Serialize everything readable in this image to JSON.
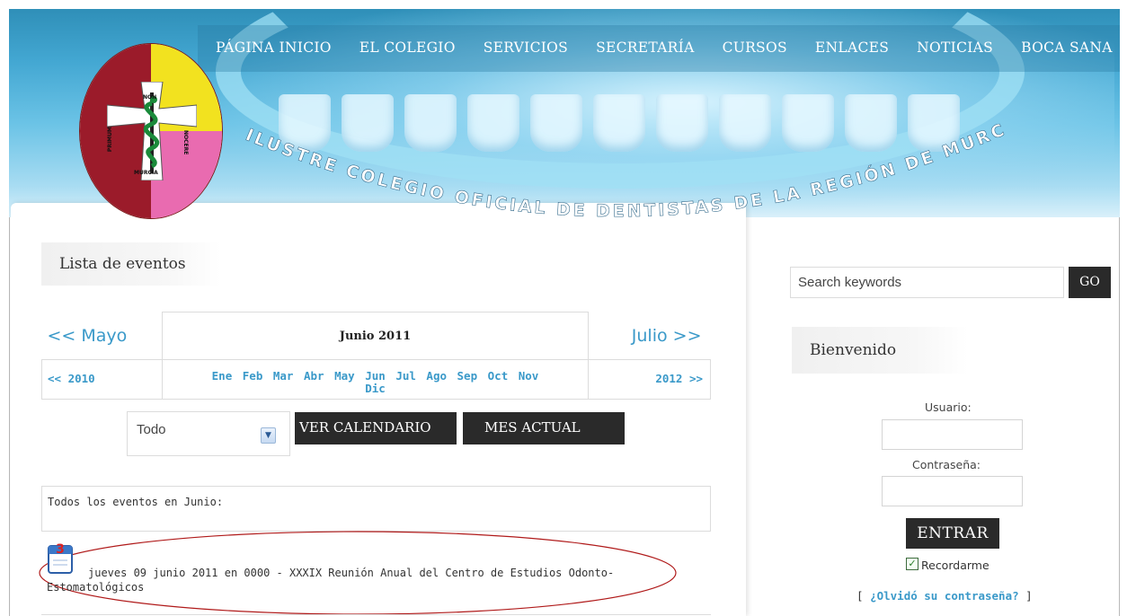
{
  "nav": {
    "items": [
      "PÁGINA INICIO",
      "EL COLEGIO",
      "SERVICIOS",
      "SECRETARÍA",
      "CURSOS",
      "ENLACES",
      "NOTICIAS",
      "BOCA SANA"
    ]
  },
  "banner": {
    "arc_text": "ILUSTRE COLEGIO OFICIAL DE DENTISTAS DE LA REGIÓN DE MURCIA",
    "logo_text": [
      "NON",
      "NOCERE",
      "MURCIA",
      "PRIMUM"
    ]
  },
  "main": {
    "section_title": "Lista de eventos",
    "calendar": {
      "prev_month": "<< Mayo",
      "current_month": "Junio 2011",
      "next_month": "Julio >>",
      "prev_year": "<< 2010",
      "next_year": "2012 >>",
      "months": [
        "Ene",
        "Feb",
        "Mar",
        "Abr",
        "May",
        "Jun",
        "Jul",
        "Ago",
        "Sep",
        "Oct",
        "Nov",
        "Dic"
      ]
    },
    "filter": {
      "selected": "Todo"
    },
    "buttons": {
      "ver_calendario": "VER CALENDARIO",
      "mes_actual": "MES ACTUAL"
    },
    "events_heading": "Todos los eventos en Junio:",
    "event_icon_day": "3",
    "event": {
      "text": "jueves 09 junio 2011 en 0000 - XXXIX Reunión Anual del Centro de Estudios Odonto-Estomatológicos"
    }
  },
  "sidebar": {
    "search": {
      "placeholder": "Search keywords",
      "button": "GO"
    },
    "welcome_title": "Bienvenido",
    "login": {
      "user_label": "Usuario:",
      "password_label": "Contraseña:",
      "submit": "ENTRAR",
      "remember_label": "Recordarme",
      "remember_checked": true,
      "bracket_open": "[",
      "forgot_link": "¿Olvidó su contraseña?",
      "bracket_close": "]"
    }
  },
  "colors": {
    "link_blue": "#3a99c9",
    "dark_button": "#2a2a2a",
    "logo_red": "#9b1b2a",
    "logo_yellow": "#f2e21f",
    "logo_pink": "#e96bb0",
    "annotation_ellipse": "#b01a1a"
  }
}
